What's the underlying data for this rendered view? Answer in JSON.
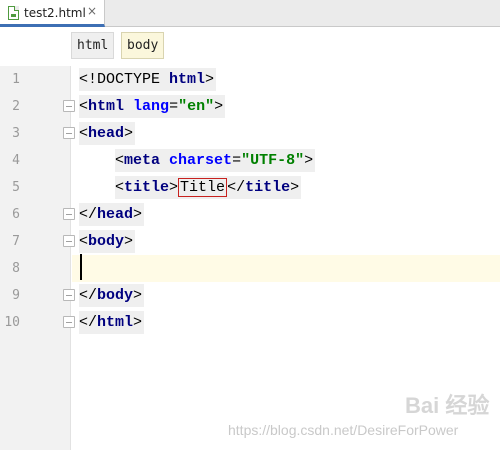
{
  "tab": {
    "label": "test2.html",
    "close": "×"
  },
  "breadcrumb": [
    "html",
    "body"
  ],
  "gutter": {
    "numbers": [
      "1",
      "2",
      "3",
      "4",
      "5",
      "6",
      "7",
      "8",
      "9",
      "10"
    ]
  },
  "code": {
    "l1": {
      "open": "<!DOCTYPE ",
      "tag": "html",
      "close": ">"
    },
    "l2": {
      "open": "<",
      "tag": "html",
      "sp": " ",
      "attr": "lang",
      "eq": "=",
      "val": "\"en\"",
      "close": ">"
    },
    "l3": {
      "open": "<",
      "tag": "head",
      "close": ">"
    },
    "l4": {
      "open": "<",
      "tag": "meta",
      "sp": " ",
      "attr": "charset",
      "eq": "=",
      "val": "\"UTF-8\"",
      "close": ">"
    },
    "l5": {
      "open": "<",
      "tag": "title",
      "close": ">",
      "text": "Title",
      "endopen": "</",
      "endtag": "title",
      "endclose": ">"
    },
    "l6": {
      "open": "</",
      "tag": "head",
      "close": ">"
    },
    "l7": {
      "open": "<",
      "tag": "body",
      "close": ">"
    },
    "l9": {
      "open": "</",
      "tag": "body",
      "close": ">"
    },
    "l10": {
      "open": "</",
      "tag": "html",
      "close": ">"
    }
  },
  "watermark": {
    "text": "https://blog.csdn.net/DesireForPower",
    "logo": "Bai 经验"
  }
}
